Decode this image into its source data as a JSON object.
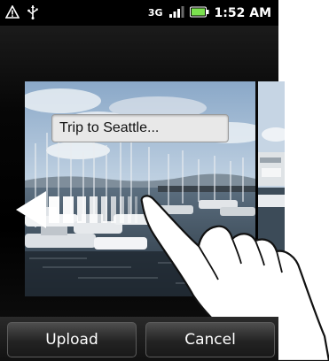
{
  "status_bar": {
    "time": "1:52 AM",
    "network_type": "3G",
    "icons": [
      "warning-icon",
      "usb-icon",
      "signal-icon",
      "battery-icon"
    ]
  },
  "photo": {
    "caption_value": "Trip to Seattle..."
  },
  "gesture": {
    "direction": "left",
    "icons": [
      "swipe-arrow-icon",
      "hand-icon"
    ]
  },
  "buttons": {
    "upload_label": "Upload",
    "cancel_label": "Cancel"
  },
  "colors": {
    "status_bar": "#000000",
    "battery": "#7be04f",
    "button_bg": "#2f2f2f"
  }
}
